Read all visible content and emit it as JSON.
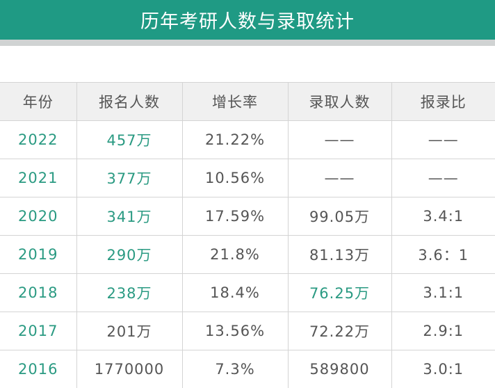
{
  "title": "历年考研人数与录取统计",
  "table": {
    "headers": [
      "年份",
      "报名人数",
      "增长率",
      "录取人数",
      "报录比"
    ],
    "rows": [
      {
        "year": "2022",
        "applicants": "457万",
        "growth": "21.22%",
        "admitted": "——",
        "ratio": "——"
      },
      {
        "year": "2021",
        "applicants": "377万",
        "growth": "10.56%",
        "admitted": "——",
        "ratio": "——"
      },
      {
        "year": "2020",
        "applicants": "341万",
        "growth": "17.59%",
        "admitted": "99.05万",
        "ratio": "3.4:1"
      },
      {
        "year": "2019",
        "applicants": "290万",
        "growth": "21.8%",
        "admitted": "81.13万",
        "ratio": "3.6：1"
      },
      {
        "year": "2018",
        "applicants": "238万",
        "growth": "18.4%",
        "admitted": "76.25万",
        "ratio": "3.1:1"
      },
      {
        "year": "2017",
        "applicants": "201万",
        "growth": "13.56%",
        "admitted": "72.22万",
        "ratio": "2.9:1"
      },
      {
        "year": "2016",
        "applicants": "1770000",
        "growth": "7.3%",
        "admitted": "589800",
        "ratio": "3.0:1"
      }
    ]
  },
  "colors": {
    "banner": "#1f9a84",
    "accent_text": "#2a9a82",
    "body_text": "#555555",
    "header_bg": "#f0f0f0"
  }
}
